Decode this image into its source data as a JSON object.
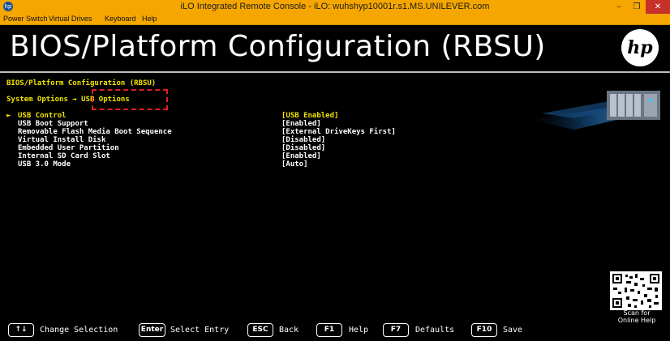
{
  "window": {
    "title": "iLO Integrated Remote Console - iLO: wuhshyp10001r.s1.MS.UNILEVER.com",
    "minimize": "–",
    "maximize": "❐",
    "close": "✕",
    "app_icon": "hp-icon"
  },
  "menu": [
    "Power Switch",
    "Virtual Drives",
    "Keyboard",
    "Help"
  ],
  "header": {
    "title": "BIOS/Platform Configuration (RBSU)",
    "logo": "hp"
  },
  "breadcrumb": {
    "line1": "BIOS/Platform Configuration (RBSU)",
    "line2_prefix": "System Options → ",
    "current": "USB Options"
  },
  "options": [
    {
      "label": "USB Control",
      "value": "[USB Enabled]",
      "selected": true
    },
    {
      "label": "USB Boot Support",
      "value": "[Enabled]"
    },
    {
      "label": "Removable Flash Media Boot Sequence",
      "value": "[External DriveKeys First]"
    },
    {
      "label": "Virtual Install Disk",
      "value": "[Disabled]"
    },
    {
      "label": "Embedded User Partition",
      "value": "[Disabled]"
    },
    {
      "label": "Internal SD Card Slot",
      "value": "[Enabled]"
    },
    {
      "label": "USB 3.0 Mode",
      "value": "[Auto]"
    }
  ],
  "selection_arrow": "►",
  "qr": {
    "caption_line1": "Scan for",
    "caption_line2": "Online Help"
  },
  "footer": [
    {
      "key": "↑↓",
      "label": "Change Selection"
    },
    {
      "key": "Enter",
      "label": "Select Entry"
    },
    {
      "key": "ESC",
      "label": "Back"
    },
    {
      "key": "F1",
      "label": "Help"
    },
    {
      "key": "F7",
      "label": "Defaults"
    },
    {
      "key": "F10",
      "label": "Save"
    }
  ],
  "colors": {
    "titlebar": "#f5a600",
    "highlight": "#f2e400",
    "annotation": "#e21f1f",
    "close": "#c7312a"
  }
}
